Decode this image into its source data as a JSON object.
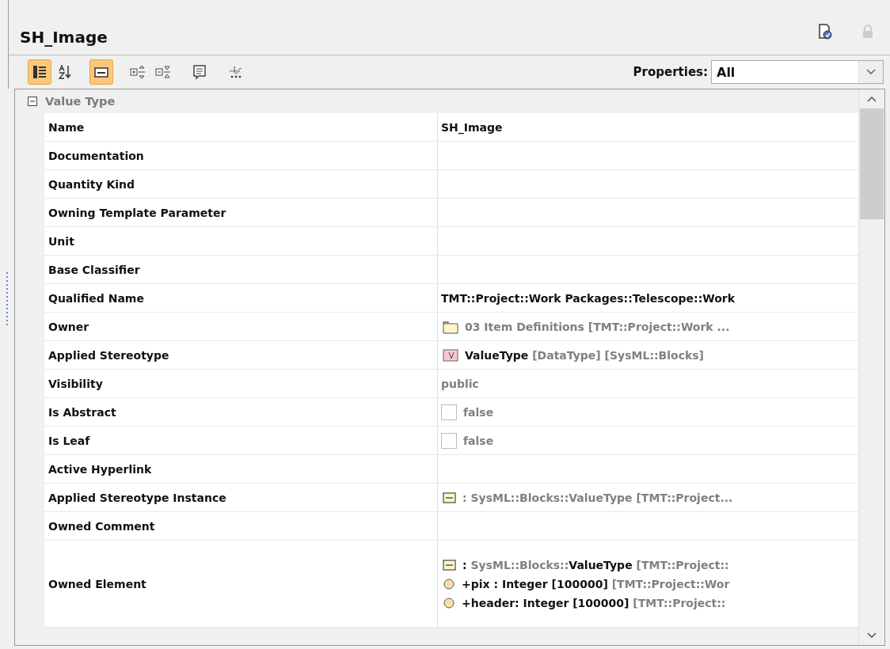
{
  "panel": {
    "title": "SH_Image"
  },
  "toolbar": [
    {
      "kind": "categorized",
      "selected": true
    },
    {
      "kind": "sort",
      "selected": false
    },
    {
      "kind": "compact",
      "selected": true
    },
    {
      "kind": "expand",
      "selected": false
    },
    {
      "kind": "collapse",
      "selected": false
    },
    {
      "kind": "note",
      "selected": false
    },
    {
      "kind": "spell",
      "selected": false
    }
  ],
  "filter": {
    "label": "Properties:",
    "value": "All"
  },
  "group": {
    "title": "Value Type",
    "expanded": true
  },
  "rows": [
    {
      "label": "Name",
      "kind": "text",
      "value": [
        {
          "text": "SH_Image",
          "kind": "plain"
        }
      ]
    },
    {
      "label": "Documentation",
      "kind": "text"
    },
    {
      "label": "Quantity Kind",
      "kind": "text"
    },
    {
      "label": "Owning Template Parameter",
      "kind": "text"
    },
    {
      "label": "Unit",
      "kind": "text"
    },
    {
      "label": "Base Classifier",
      "kind": "text"
    },
    {
      "label": "Qualified Name",
      "kind": "text",
      "value": [
        {
          "text": "TMT::Project::Work Packages::Telescope::Work",
          "kind": "plain"
        }
      ]
    },
    {
      "label": "Owner",
      "kind": "folder",
      "value": [
        {
          "text": "03 Item Definitions [TMT::Project::Work ...",
          "kind": "muted"
        }
      ]
    },
    {
      "label": "Applied Stereotype",
      "kind": "stereotype",
      "value": [
        {
          "text": "ValueType",
          "kind": "plain"
        },
        {
          "text": " [DataType] [SysML::Blocks]",
          "kind": "muted"
        }
      ]
    },
    {
      "label": "Visibility",
      "kind": "text",
      "value": [
        {
          "text": "public",
          "kind": "muted"
        }
      ]
    },
    {
      "label": "Is Abstract",
      "kind": "checkbox",
      "checked": false,
      "value": [
        {
          "text": "false",
          "kind": "muted"
        }
      ]
    },
    {
      "label": "Is Leaf",
      "kind": "checkbox",
      "checked": false,
      "value": [
        {
          "text": "false",
          "kind": "muted"
        }
      ]
    },
    {
      "label": "Active Hyperlink",
      "kind": "text"
    },
    {
      "label": "Applied Stereotype Instance",
      "kind": "instance",
      "value": [
        {
          "text": " : SysML::Blocks::ValueType [TMT::Project...",
          "kind": "muted"
        }
      ]
    },
    {
      "label": "Owned Comment",
      "kind": "text"
    },
    {
      "label": "Owned Element",
      "kind": "list",
      "items": [
        {
          "kind": "instance",
          "value": [
            {
              "text": " : ",
              "kind": "plain"
            },
            {
              "text": "SysML::Blocks::",
              "kind": "muted"
            },
            {
              "text": "ValueType",
              "kind": "plain"
            },
            {
              "text": " [TMT::Project::",
              "kind": "muted"
            }
          ]
        },
        {
          "kind": "property",
          "value": [
            {
              "text": "+pix",
              "kind": "plain"
            },
            {
              "text": " : Integer [100000]",
              "kind": "plain"
            },
            {
              "text": " [TMT::Project::Wor",
              "kind": "muted"
            }
          ]
        },
        {
          "kind": "property",
          "value": [
            {
              "text": "+header",
              "kind": "plain"
            },
            {
              "text": ": Integer [100000]",
              "kind": "plain"
            },
            {
              "text": " [TMT::Project::",
              "kind": "muted"
            }
          ]
        }
      ]
    }
  ]
}
